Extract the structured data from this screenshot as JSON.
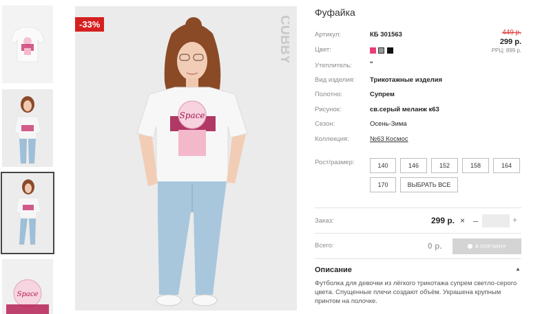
{
  "badge": {
    "discount": "-33%"
  },
  "brand": {
    "name": "CUBBY"
  },
  "print_text": "Space",
  "product": {
    "title": "Фуфайка"
  },
  "specs": [
    {
      "label": "Артикул:",
      "value": "КБ 301563"
    },
    {
      "label": "Цвет:",
      "value": ""
    },
    {
      "label": "Утеплитель:",
      "value": "\""
    },
    {
      "label": "Вид изделия:",
      "value": "Трикотажные изделия"
    },
    {
      "label": "Полотно:",
      "value": "Супрем"
    },
    {
      "label": "Рисунок:",
      "value": "св.серый меланж к63"
    },
    {
      "label": "Сезон:",
      "value": "Осень-Зима"
    },
    {
      "label": "Коллекция:",
      "value": "№63 Космос"
    }
  ],
  "colors": [
    {
      "name": "pink",
      "hex": "#e83e7a"
    },
    {
      "name": "grey",
      "hex": "#9a9a9a"
    },
    {
      "name": "black",
      "hex": "#111111"
    }
  ],
  "price": {
    "old": "449 р.",
    "current": "299 р.",
    "rrp": "РРЦ: 899 р."
  },
  "sizes": {
    "label": "Рост/размер:",
    "options": [
      "140",
      "146",
      "152",
      "158",
      "164",
      "170"
    ],
    "select_all": "ВЫБРАТЬ ВСЕ"
  },
  "order": {
    "label": "Заказ:",
    "price": "299 р.",
    "times": "×",
    "minus": "–",
    "plus": "+",
    "quantity": ""
  },
  "total": {
    "label": "Всего:",
    "value": "0 р.",
    "cart_button": "В КОРЗИНУ"
  },
  "description": {
    "title": "Описание",
    "toggle": "▲",
    "text": "Футболка для девочки из лёгкого трикотажа супрем светло-серого цвета. Спущенные плечи создают объём. Украшена крупным принтом на полочке."
  }
}
